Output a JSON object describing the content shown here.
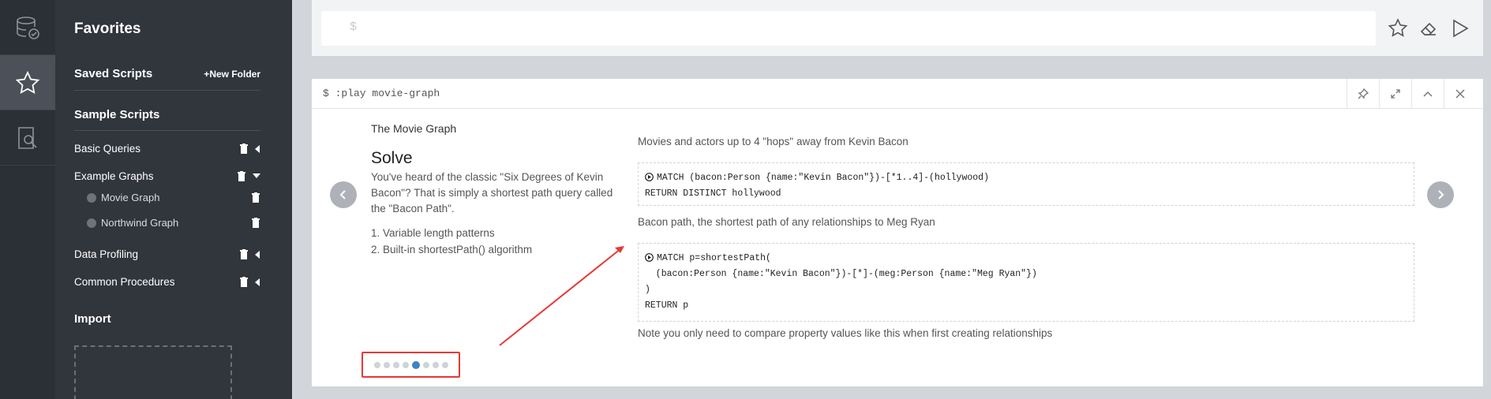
{
  "rail": {
    "items": [
      "database-icon",
      "star-icon",
      "search-doc-icon"
    ]
  },
  "drawer": {
    "title": "Favorites",
    "saved_scripts": "Saved Scripts",
    "new_folder": "New Folder",
    "sample_scripts": "Sample Scripts",
    "items": [
      {
        "label": "Basic Queries"
      },
      {
        "label": "Example Graphs"
      },
      {
        "label": "Data Profiling"
      },
      {
        "label": "Common Procedures"
      }
    ],
    "sub_items": [
      {
        "label": "Movie Graph"
      },
      {
        "label": "Northwind Graph"
      }
    ],
    "import": "Import"
  },
  "editor": {
    "prompt": "$"
  },
  "frame": {
    "command": "$ :play movie-graph",
    "kicker": "The Movie Graph",
    "title": "Solve",
    "body": "You've heard of the classic \"Six Degrees of Kevin Bacon\"? That is simply a shortest path query called the \"Bacon Path\".",
    "list": [
      "1. Variable length patterns",
      "2. Built-in shortestPath() algorithm"
    ],
    "desc1": "Movies and actors up to 4 \"hops\" away from Kevin Bacon",
    "code1_line1": "MATCH (bacon:Person {name:\"Kevin Bacon\"})-[*1..4]-(hollywood)",
    "code1_line2": "RETURN DISTINCT hollywood",
    "desc2": "Bacon path, the shortest path of any relationships to Meg Ryan",
    "code2_line1": "MATCH p=shortestPath(",
    "code2_line2": "  (bacon:Person {name:\"Kevin Bacon\"})-[*]-(meg:Person {name:\"Meg Ryan\"})",
    "code2_line3": ")",
    "code2_line4": "RETURN p",
    "desc3": "Note you only need to compare property values like this when first creating relationships",
    "slides": {
      "total": 8,
      "current": 5
    }
  },
  "colors": {
    "accent": "#3d84c6",
    "highlight": "#e53935",
    "drawer_bg": "#31353c",
    "rail_bg": "#2b2f36"
  }
}
